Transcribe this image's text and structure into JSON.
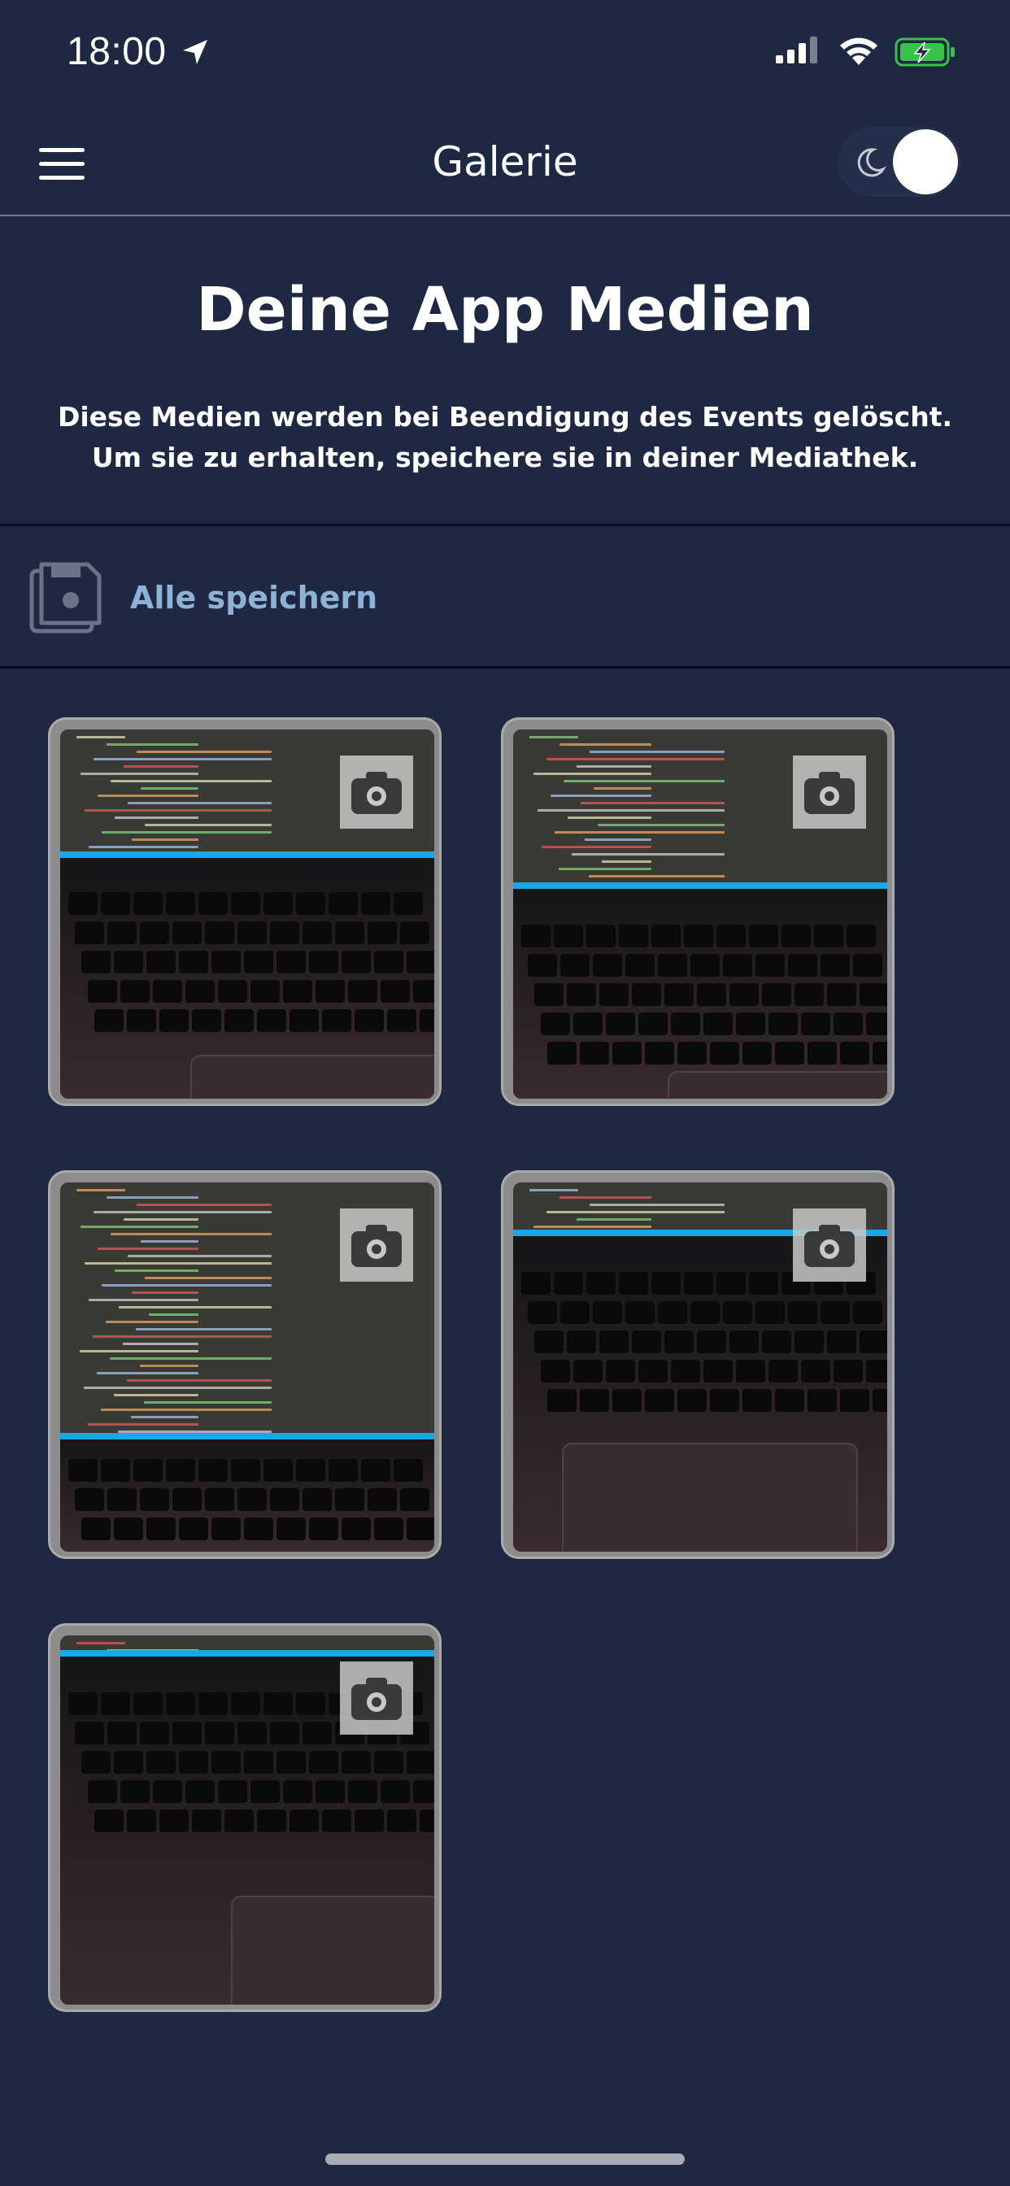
{
  "status_bar": {
    "time": "18:00",
    "icons": [
      "location-arrow-icon",
      "cellular-signal-icon",
      "wifi-icon",
      "battery-charging-icon"
    ]
  },
  "nav": {
    "title": "Galerie",
    "menu_icon": "hamburger-menu-icon",
    "theme_toggle_icon": "moon-icon"
  },
  "header": {
    "heading": "Deine App Medien",
    "info": "Diese Medien werden bei Beendigung des Events gelöscht. Um sie zu erhalten, speichere sie in deiner Mediathek."
  },
  "save_all": {
    "label": "Alle speichern",
    "icon": "floppy-disk-icon"
  },
  "gallery": {
    "items": [
      {
        "type": "photo",
        "badge_icon": "camera-icon"
      },
      {
        "type": "photo",
        "badge_icon": "camera-icon"
      },
      {
        "type": "photo",
        "badge_icon": "camera-icon"
      },
      {
        "type": "photo",
        "badge_icon": "camera-icon"
      },
      {
        "type": "photo",
        "badge_icon": "camera-icon"
      }
    ]
  },
  "colors": {
    "background": "#1e2842",
    "accent_link": "#8fb1d6",
    "tile_frame": "#8c8c8c"
  }
}
